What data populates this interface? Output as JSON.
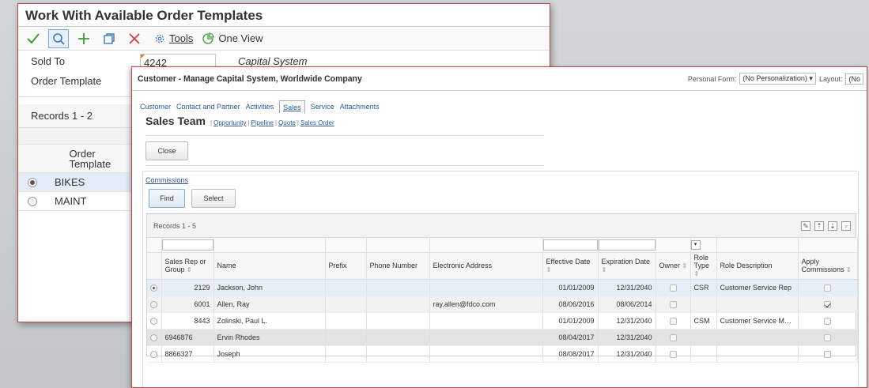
{
  "back_window": {
    "title": "Work With Available Order Templates",
    "toolbar": {
      "ok_icon": "check-icon",
      "find_icon": "search-icon",
      "add_icon": "plus-icon",
      "copy_icon": "copy-icon",
      "delete_icon": "x-icon",
      "tools_label": "Tools",
      "oneview_label": "One View"
    },
    "sold_to_label": "Sold To",
    "sold_to_value": "4242",
    "sold_to_desc": "Capital System",
    "order_template_label": "Order Template",
    "records_label": "Records 1 - 2",
    "grid_header": "Order Template",
    "rows": [
      {
        "value": "BIKES",
        "selected": true
      },
      {
        "value": "MAINT",
        "selected": false
      }
    ]
  },
  "front_window": {
    "title": "Customer - Manage Capital System, Worldwide Company",
    "personal_form_label": "Personal Form:",
    "personal_form_value": "(No Personalization)",
    "layout_label": "Layout:",
    "layout_value": "(No",
    "tabs": [
      {
        "label": "Customer",
        "active": false
      },
      {
        "label": "Contact and Partner",
        "active": false
      },
      {
        "label": "Activities",
        "active": false
      },
      {
        "label": "Sales",
        "active": true
      },
      {
        "label": "Service",
        "active": false
      },
      {
        "label": "Attachments",
        "active": false
      }
    ],
    "section_title": "Sales Team",
    "section_links": [
      "Opportunity",
      "Pipeline",
      "Quote",
      "Sales Order"
    ],
    "close_label": "Close",
    "commissions_label": "Commissions",
    "find_label": "Find",
    "select_label": "Select",
    "records_label": "Records 1 - 5",
    "grid": {
      "columns": [
        "Sales Rep or Group",
        "Name",
        "Prefix",
        "Phone Number",
        "Electronic Address",
        "Effective Date",
        "Expiration Date",
        "Owner",
        "Role Type",
        "Role Description",
        "Apply Commissions"
      ],
      "rows": [
        {
          "rep": "2129",
          "name": "Jackson, John",
          "prefix": "",
          "phone": "",
          "email": "",
          "effective": "01/01/2009",
          "expiration": "12/31/2040",
          "owner": false,
          "role_type": "CSR",
          "role_desc": "Customer Service Rep",
          "apply": false,
          "selected": true
        },
        {
          "rep": "6001",
          "name": "Allen, Ray",
          "prefix": "",
          "phone": "",
          "email": "ray.allen@fdco.com",
          "effective": "08/06/2016",
          "expiration": "08/06/2014",
          "owner": false,
          "role_type": "",
          "role_desc": "",
          "apply": true,
          "selected": false
        },
        {
          "rep": "8443",
          "name": "Zolinski, Paul L.",
          "prefix": "",
          "phone": "",
          "email": "",
          "effective": "01/01/2009",
          "expiration": "12/31/2040",
          "owner": false,
          "role_type": "CSM",
          "role_desc": "Customer Service Mana...",
          "apply": false,
          "selected": false
        },
        {
          "rep": "6946876",
          "name": "Ervin Rhodes",
          "prefix": "",
          "phone": "",
          "email": "",
          "effective": "08/04/2017",
          "expiration": "12/31/2040",
          "owner": false,
          "role_type": "",
          "role_desc": "",
          "apply": false,
          "selected": false
        },
        {
          "rep": "8866327",
          "name": "Joseph",
          "prefix": "",
          "phone": "",
          "email": "",
          "effective": "08/08/2017",
          "expiration": "12/31/2040",
          "owner": false,
          "role_type": "",
          "role_desc": "",
          "apply": false,
          "selected": false
        }
      ]
    }
  },
  "colors": {
    "window_border": "#b74b4b",
    "link_blue": "#2a5c9b",
    "toolbar_green": "#3c9a3c",
    "toolbar_blue": "#3d79c1",
    "delete_red": "#d23c3c"
  }
}
